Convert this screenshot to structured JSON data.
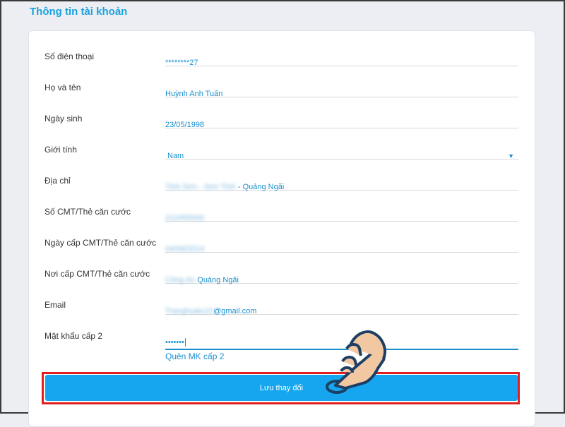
{
  "page": {
    "title": "Thông tin tài khoản"
  },
  "form": {
    "phone": {
      "label": "Số điện thoại",
      "value": "********27"
    },
    "fullname": {
      "label": "Họ và tên",
      "value": "Huỳnh Anh Tuấn"
    },
    "birthday": {
      "label": "Ngày sinh",
      "value": "23/05/1998"
    },
    "gender": {
      "label": "Giới tính",
      "value": "Nam"
    },
    "address": {
      "label": "Địa chỉ",
      "value_hidden": "Tịnh Sơn - Sơn Tịnh",
      "value_visible": " - Quảng Ngãi"
    },
    "id_number": {
      "label": "Số CMT/Thẻ căn cước",
      "value_hidden": "212450000"
    },
    "id_issue_date": {
      "label": "Ngày cấp CMT/Thẻ căn cước",
      "value_hidden": "04/08/2014"
    },
    "id_issue_place": {
      "label": "Nơi cấp CMT/Thẻ căn cước",
      "value_hidden": "Công An",
      "value_visible": " Quảng Ngãi"
    },
    "email": {
      "label": "Email",
      "value_hidden": "Tranghuatu10",
      "value_visible": "@gmail.com"
    },
    "password2": {
      "label": "Mật khẩu cấp 2",
      "value": "•••••••"
    }
  },
  "forgot_link": "Quên MK cấp 2",
  "save_button": "Lưu thay đổi",
  "colors": {
    "accent": "#1aa3dc",
    "button": "#16a6ef",
    "highlight": "#e02020"
  }
}
